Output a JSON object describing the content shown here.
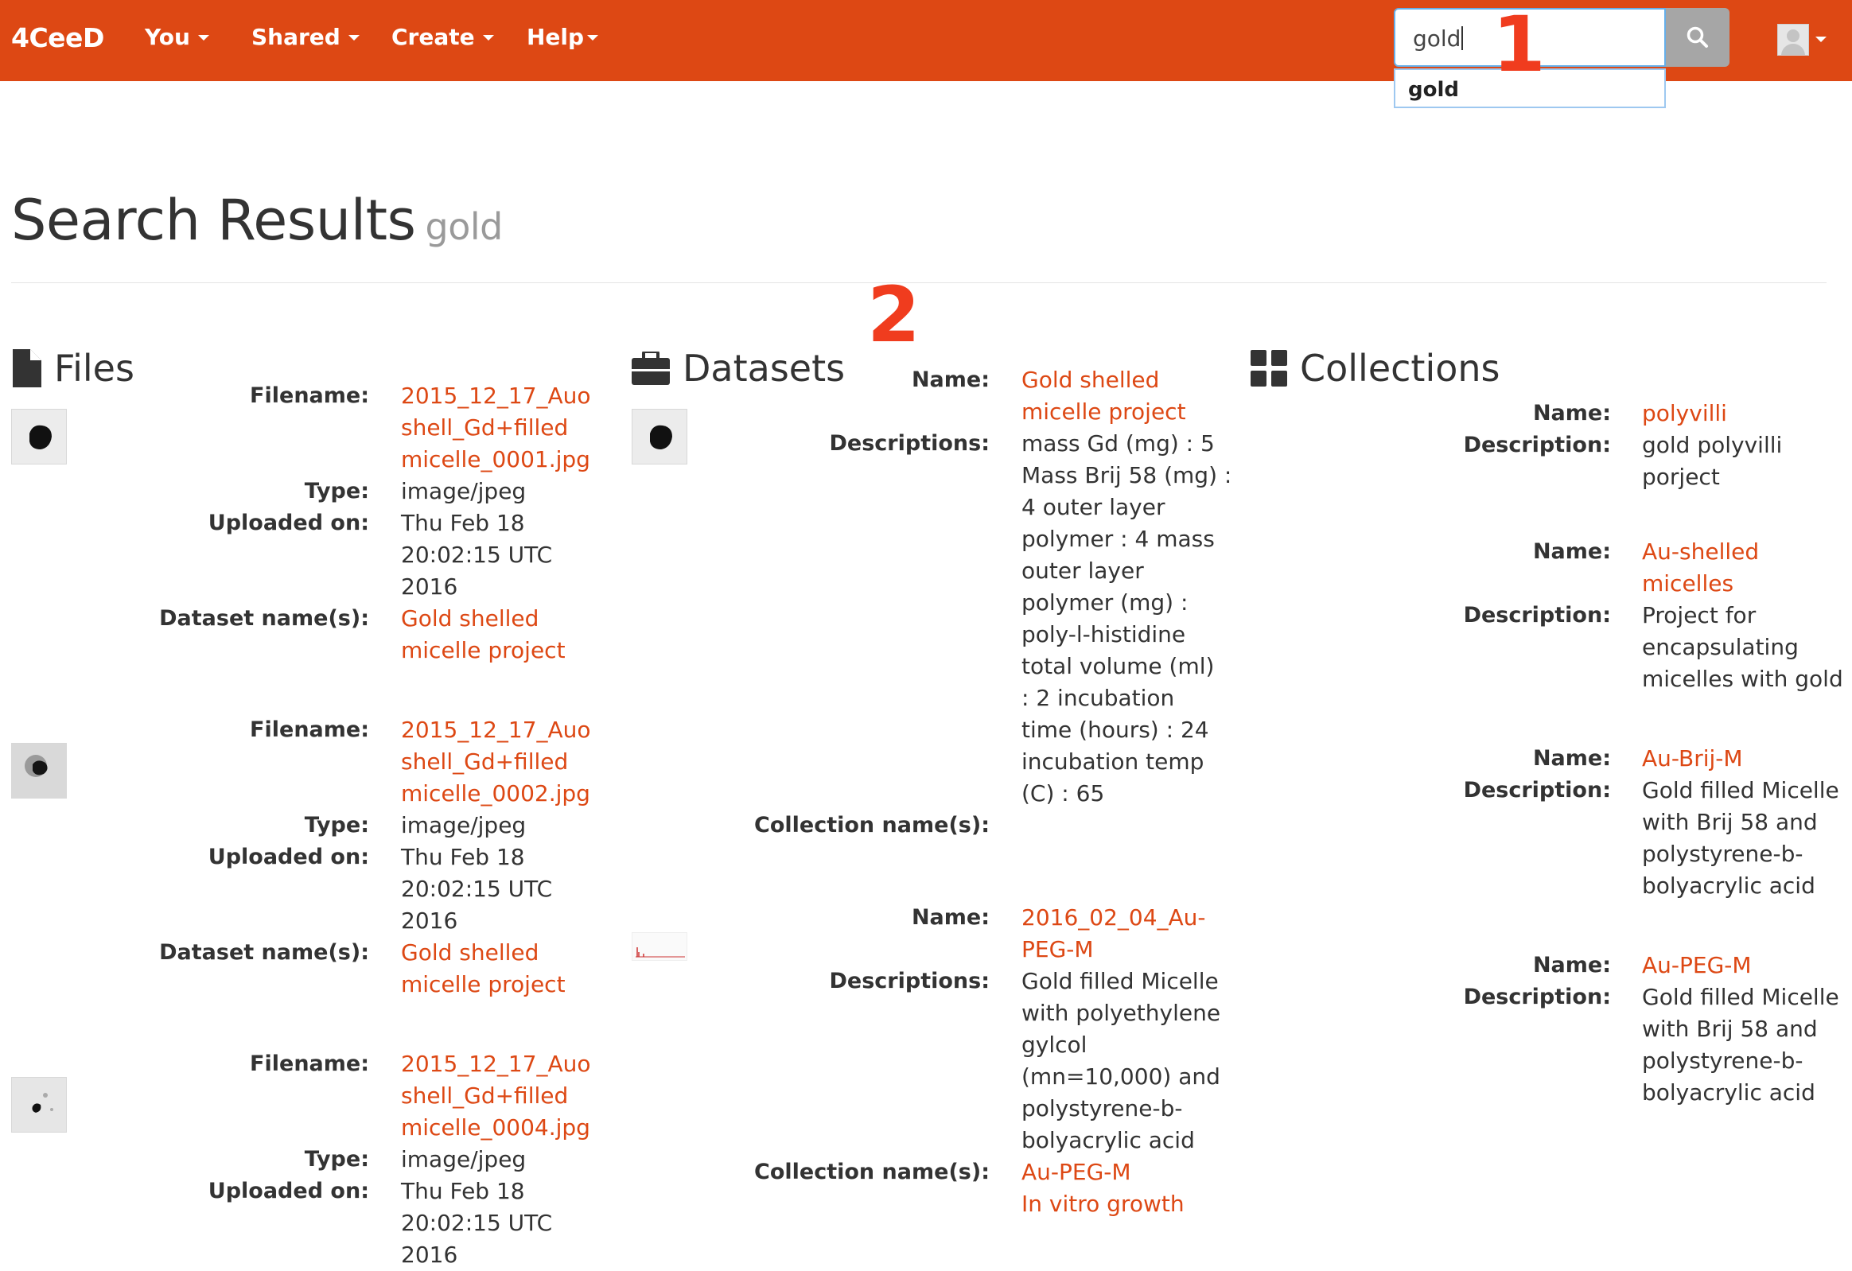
{
  "navbar": {
    "brand": "4CeeD",
    "menus": [
      "You",
      "Shared",
      "Create",
      "Help"
    ],
    "search_value": "gold",
    "suggestion": "gold"
  },
  "annotations": {
    "one": "1",
    "two": "2"
  },
  "page": {
    "title": "Search Results",
    "query": "gold"
  },
  "sections": {
    "files": "Files",
    "datasets": "Datasets",
    "collections": "Collections"
  },
  "labels": {
    "filename": "Filename:",
    "type": "Type:",
    "uploaded": "Uploaded on:",
    "dataset_names": "Dataset name(s):",
    "name": "Name:",
    "descriptions": "Descriptions:",
    "collection_names": "Collection name(s):",
    "description": "Description:"
  },
  "files": [
    {
      "filename": [
        "2015_12_17_Auo",
        "shell_Gd+filled",
        "micelle_0001.jpg"
      ],
      "type": "image/jpeg",
      "uploaded": [
        "Thu Feb 18",
        "20:02:15 UTC",
        "2016"
      ],
      "datasets": [
        "Gold shelled",
        "micelle project"
      ]
    },
    {
      "filename": [
        "2015_12_17_Auo",
        "shell_Gd+filled",
        "micelle_0002.jpg"
      ],
      "type": "image/jpeg",
      "uploaded": [
        "Thu Feb 18",
        "20:02:15 UTC",
        "2016"
      ],
      "datasets": [
        "Gold shelled",
        "micelle project"
      ]
    },
    {
      "filename": [
        "2015_12_17_Auo",
        "shell_Gd+filled",
        "micelle_0004.jpg"
      ],
      "type": "image/jpeg",
      "uploaded": [
        "Thu Feb 18",
        "20:02:15 UTC",
        "2016"
      ]
    }
  ],
  "datasets": [
    {
      "name": [
        "Gold shelled",
        "micelle project"
      ],
      "descriptions": [
        "mass Gd (mg) : 5",
        "Mass Brij 58 (mg) :",
        "4 outer layer",
        "polymer : 4 mass",
        "outer layer",
        "polymer (mg) :",
        "poly-l-histidine",
        "total volume (ml)",
        ": 2 incubation",
        "time (hours) : 24",
        "incubation temp",
        "(C) : 65"
      ],
      "collections": []
    },
    {
      "name": [
        "2016_02_04_Au-",
        "PEG-M"
      ],
      "descriptions": [
        "Gold filled Micelle",
        "with polyethylene",
        "gylcol",
        "(mn=10,000) and",
        "polystyrene-b-",
        "bolyacrylic acid"
      ],
      "collections": [
        "Au-PEG-M",
        "In vitro growth"
      ]
    }
  ],
  "collections": [
    {
      "name": [
        "polyvilli"
      ],
      "description": [
        "gold polyvilli",
        "porject"
      ]
    },
    {
      "name": [
        "Au-shelled",
        "micelles"
      ],
      "description": [
        "Project for",
        "encapsulating",
        "micelles with gold"
      ]
    },
    {
      "name": [
        "Au-Brij-M"
      ],
      "description": [
        "Gold filled Micelle",
        "with Brij 58 and",
        "polystyrene-b-",
        "bolyacrylic acid"
      ]
    },
    {
      "name": [
        "Au-PEG-M"
      ],
      "description": [
        "Gold filled Micelle",
        "with Brij 58 and",
        "polystyrene-b-",
        "bolyacrylic acid"
      ]
    }
  ],
  "colors": {
    "brand": "#dd4814",
    "annotation": "#f03c1e",
    "search_button": "#a6a6a6"
  }
}
